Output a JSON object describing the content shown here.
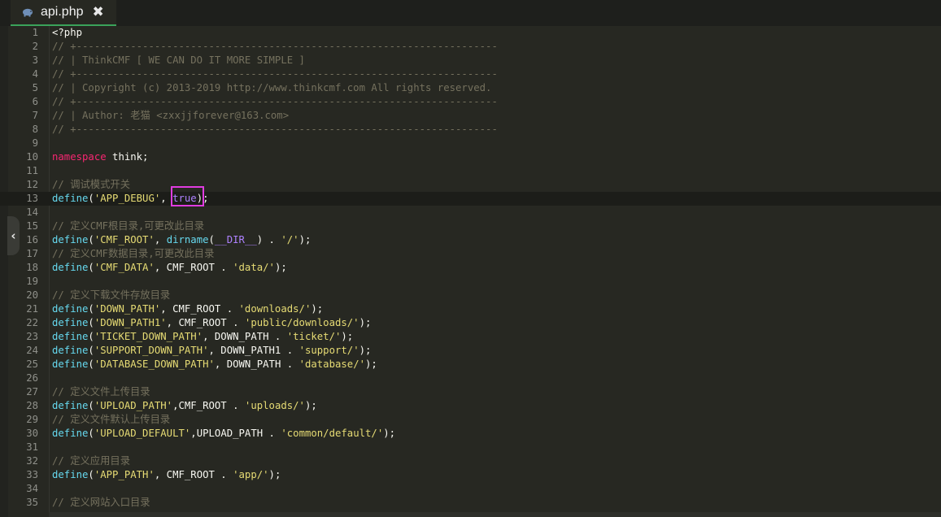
{
  "tab": {
    "title": "api.php",
    "icon": "php-elephant-icon",
    "close_glyph": "✖"
  },
  "collapse_glyph": "‹",
  "code_lines": [
    {
      "n": "1",
      "parts": [
        [
          "pl",
          "<?php"
        ]
      ]
    },
    {
      "n": "2",
      "parts": [
        [
          "cm",
          "// +----------------------------------------------------------------------"
        ]
      ]
    },
    {
      "n": "3",
      "parts": [
        [
          "cm",
          "// | ThinkCMF [ WE CAN DO IT MORE SIMPLE ]"
        ]
      ]
    },
    {
      "n": "4",
      "parts": [
        [
          "cm",
          "// +----------------------------------------------------------------------"
        ]
      ]
    },
    {
      "n": "5",
      "parts": [
        [
          "cm",
          "// | Copyright (c) 2013-2019 http://www.thinkcmf.com All rights reserved."
        ]
      ]
    },
    {
      "n": "6",
      "parts": [
        [
          "cm",
          "// +----------------------------------------------------------------------"
        ]
      ]
    },
    {
      "n": "7",
      "parts": [
        [
          "cm",
          "// | Author: 老猫 <zxxjjforever@163.com>"
        ]
      ]
    },
    {
      "n": "8",
      "parts": [
        [
          "cm",
          "// +----------------------------------------------------------------------"
        ]
      ]
    },
    {
      "n": "9",
      "parts": []
    },
    {
      "n": "10",
      "parts": [
        [
          "kw",
          "namespace"
        ],
        [
          "pl",
          " think;"
        ]
      ]
    },
    {
      "n": "11",
      "parts": []
    },
    {
      "n": "12",
      "parts": [
        [
          "cm",
          "// 调试模式开关"
        ]
      ]
    },
    {
      "n": "13",
      "parts": [
        [
          "fn",
          "define"
        ],
        [
          "pl",
          "("
        ],
        [
          "st",
          "'APP_DEBUG'"
        ],
        [
          "pl",
          ", "
        ],
        [
          "bl",
          "true"
        ],
        [
          "pl",
          ");"
        ]
      ],
      "active": true
    },
    {
      "n": "14",
      "parts": []
    },
    {
      "n": "15",
      "parts": [
        [
          "cm",
          "// 定义CMF根目录,可更改此目录"
        ]
      ]
    },
    {
      "n": "16",
      "parts": [
        [
          "fn",
          "define"
        ],
        [
          "pl",
          "("
        ],
        [
          "st",
          "'CMF_ROOT'"
        ],
        [
          "pl",
          ", "
        ],
        [
          "fn",
          "dirname"
        ],
        [
          "pl",
          "("
        ],
        [
          "bl",
          "__DIR__"
        ],
        [
          "pl",
          ") . "
        ],
        [
          "st",
          "'/'"
        ],
        [
          "pl",
          ");"
        ]
      ]
    },
    {
      "n": "17",
      "parts": [
        [
          "cm",
          "// 定义CMF数据目录,可更改此目录"
        ]
      ]
    },
    {
      "n": "18",
      "parts": [
        [
          "fn",
          "define"
        ],
        [
          "pl",
          "("
        ],
        [
          "st",
          "'CMF_DATA'"
        ],
        [
          "pl",
          ", CMF_ROOT . "
        ],
        [
          "st",
          "'data/'"
        ],
        [
          "pl",
          ");"
        ]
      ]
    },
    {
      "n": "19",
      "parts": []
    },
    {
      "n": "20",
      "parts": [
        [
          "cm",
          "// 定义下载文件存放目录"
        ]
      ]
    },
    {
      "n": "21",
      "parts": [
        [
          "fn",
          "define"
        ],
        [
          "pl",
          "("
        ],
        [
          "st",
          "'DOWN_PATH'"
        ],
        [
          "pl",
          ", CMF_ROOT . "
        ],
        [
          "st",
          "'downloads/'"
        ],
        [
          "pl",
          ");"
        ]
      ]
    },
    {
      "n": "22",
      "parts": [
        [
          "fn",
          "define"
        ],
        [
          "pl",
          "("
        ],
        [
          "st",
          "'DOWN_PATH1'"
        ],
        [
          "pl",
          ", CMF_ROOT . "
        ],
        [
          "st",
          "'public/downloads/'"
        ],
        [
          "pl",
          ");"
        ]
      ]
    },
    {
      "n": "23",
      "parts": [
        [
          "fn",
          "define"
        ],
        [
          "pl",
          "("
        ],
        [
          "st",
          "'TICKET_DOWN_PATH'"
        ],
        [
          "pl",
          ", DOWN_PATH . "
        ],
        [
          "st",
          "'ticket/'"
        ],
        [
          "pl",
          ");"
        ]
      ]
    },
    {
      "n": "24",
      "parts": [
        [
          "fn",
          "define"
        ],
        [
          "pl",
          "("
        ],
        [
          "st",
          "'SUPPORT_DOWN_PATH'"
        ],
        [
          "pl",
          ", DOWN_PATH1 . "
        ],
        [
          "st",
          "'support/'"
        ],
        [
          "pl",
          ");"
        ]
      ]
    },
    {
      "n": "25",
      "parts": [
        [
          "fn",
          "define"
        ],
        [
          "pl",
          "("
        ],
        [
          "st",
          "'DATABASE_DOWN_PATH'"
        ],
        [
          "pl",
          ", DOWN_PATH . "
        ],
        [
          "st",
          "'database/'"
        ],
        [
          "pl",
          ");"
        ]
      ]
    },
    {
      "n": "26",
      "parts": []
    },
    {
      "n": "27",
      "parts": [
        [
          "cm",
          "// 定义文件上传目录"
        ]
      ]
    },
    {
      "n": "28",
      "parts": [
        [
          "fn",
          "define"
        ],
        [
          "pl",
          "("
        ],
        [
          "st",
          "'UPLOAD_PATH'"
        ],
        [
          "pl",
          ",CMF_ROOT . "
        ],
        [
          "st",
          "'uploads/'"
        ],
        [
          "pl",
          ");"
        ]
      ]
    },
    {
      "n": "29",
      "parts": [
        [
          "cm",
          "// 定义文件默认上传目录"
        ]
      ]
    },
    {
      "n": "30",
      "parts": [
        [
          "fn",
          "define"
        ],
        [
          "pl",
          "("
        ],
        [
          "st",
          "'UPLOAD_DEFAULT'"
        ],
        [
          "pl",
          ",UPLOAD_PATH . "
        ],
        [
          "st",
          "'common/default/'"
        ],
        [
          "pl",
          ");"
        ]
      ]
    },
    {
      "n": "31",
      "parts": []
    },
    {
      "n": "32",
      "parts": [
        [
          "cm",
          "// 定义应用目录"
        ]
      ]
    },
    {
      "n": "33",
      "parts": [
        [
          "fn",
          "define"
        ],
        [
          "pl",
          "("
        ],
        [
          "st",
          "'APP_PATH'"
        ],
        [
          "pl",
          ", CMF_ROOT . "
        ],
        [
          "st",
          "'app/'"
        ],
        [
          "pl",
          ");"
        ]
      ]
    },
    {
      "n": "34",
      "parts": []
    },
    {
      "n": "35",
      "parts": [
        [
          "cm",
          "// 定义网站入口目录"
        ]
      ]
    }
  ]
}
